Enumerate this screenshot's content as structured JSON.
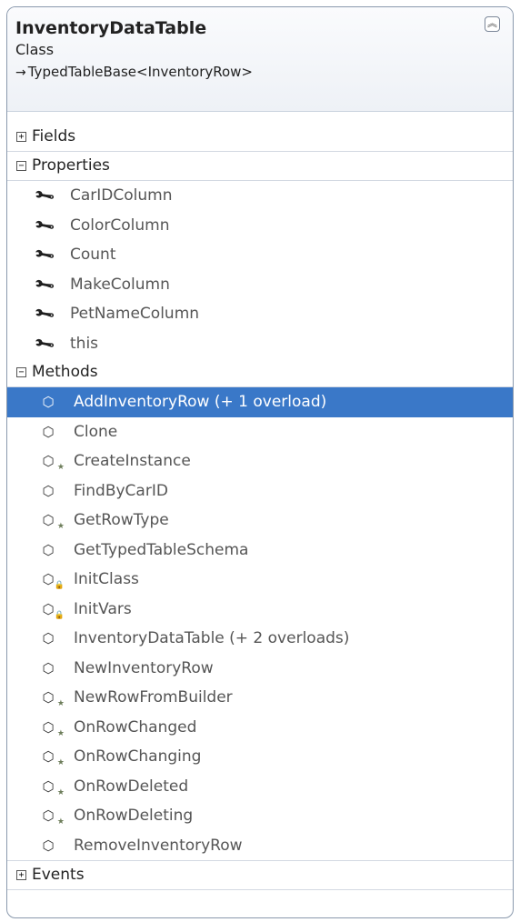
{
  "header": {
    "title": "InventoryDataTable",
    "kind": "Class",
    "base_arrow": "→",
    "base": "TypedTableBase<InventoryRow>",
    "collapse_icon": "double-chevron-up-icon"
  },
  "sections": {
    "fields": {
      "label": "Fields",
      "toggle": "+"
    },
    "properties": {
      "label": "Properties",
      "toggle": "−",
      "items": [
        "CarIDColumn",
        "ColorColumn",
        "Count",
        "MakeColumn",
        "PetNameColumn",
        "this"
      ]
    },
    "methods": {
      "label": "Methods",
      "toggle": "−",
      "items": [
        {
          "label": "AddInventoryRow (+ 1 overload)",
          "selected": true
        },
        {
          "label": "Clone"
        },
        {
          "label": "CreateInstance",
          "badge": "★"
        },
        {
          "label": "FindByCarID"
        },
        {
          "label": "GetRowType",
          "badge": "★"
        },
        {
          "label": "GetTypedTableSchema"
        },
        {
          "label": "InitClass",
          "badge": "🔒"
        },
        {
          "label": "InitVars",
          "badge": "🔒"
        },
        {
          "label": "InventoryDataTable (+ 2 overloads)"
        },
        {
          "label": "NewInventoryRow"
        },
        {
          "label": "NewRowFromBuilder",
          "badge": "★"
        },
        {
          "label": "OnRowChanged",
          "badge": "★"
        },
        {
          "label": "OnRowChanging",
          "badge": "★"
        },
        {
          "label": "OnRowDeleted",
          "badge": "★"
        },
        {
          "label": "OnRowDeleting",
          "badge": "★"
        },
        {
          "label": "RemoveInventoryRow"
        }
      ]
    },
    "events": {
      "label": "Events",
      "toggle": "+"
    }
  },
  "colors": {
    "selection": "#3a78c8",
    "border": "#8a99ad"
  }
}
